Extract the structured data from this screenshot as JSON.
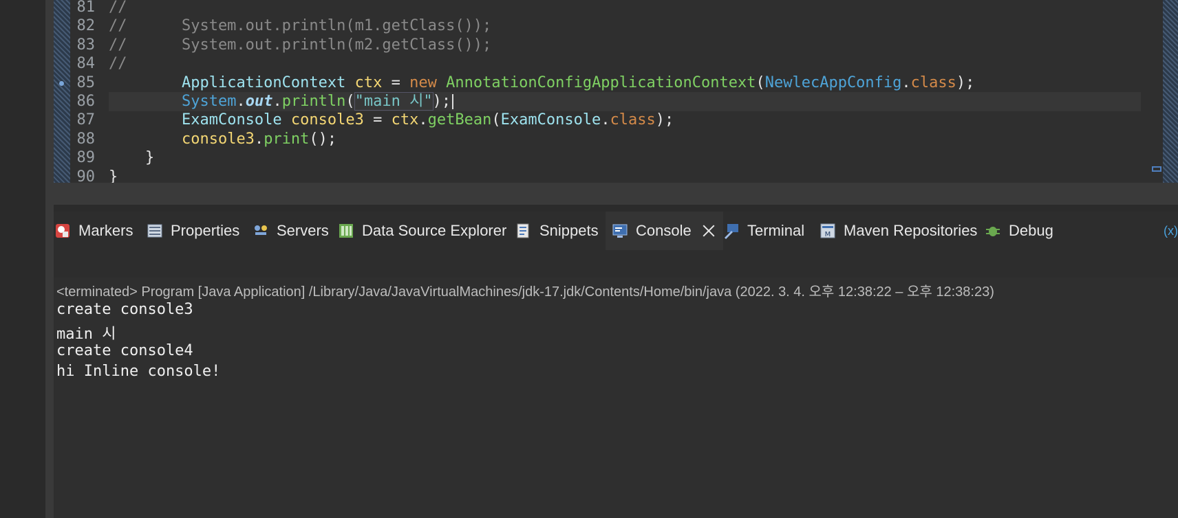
{
  "editor": {
    "lines": [
      {
        "no": "81",
        "segments": [
          {
            "t": "//",
            "c": "cm"
          }
        ]
      },
      {
        "no": "82",
        "segments": [
          {
            "t": "//      System.out.println(m1.getClass());",
            "c": "cm"
          }
        ]
      },
      {
        "no": "83",
        "segments": [
          {
            "t": "//      System.out.println(m2.getClass());",
            "c": "cm"
          }
        ]
      },
      {
        "no": "84",
        "segments": [
          {
            "t": "//",
            "c": "cm"
          }
        ]
      },
      {
        "no": "85",
        "bp": true,
        "segments": [
          {
            "t": "        ",
            "c": "pl"
          },
          {
            "t": "ApplicationContext",
            "c": "ty"
          },
          {
            "t": " ",
            "c": "pl"
          },
          {
            "t": "ctx",
            "c": "vr"
          },
          {
            "t": " = ",
            "c": "pl"
          },
          {
            "t": "new",
            "c": "kw"
          },
          {
            "t": " ",
            "c": "pl"
          },
          {
            "t": "AnnotationConfigApplicationContext",
            "c": "cl"
          },
          {
            "t": "(",
            "c": "pl"
          },
          {
            "t": "NewlecAppConfig",
            "c": "cl2"
          },
          {
            "t": ".",
            "c": "pl"
          },
          {
            "t": "class",
            "c": "kw"
          },
          {
            "t": ");",
            "c": "pl"
          }
        ]
      },
      {
        "no": "86",
        "current": true,
        "segments": [
          {
            "t": "        ",
            "c": "pl"
          },
          {
            "t": "System",
            "c": "cl2"
          },
          {
            "t": ".",
            "c": "pl"
          },
          {
            "t": "out",
            "c": "fld"
          },
          {
            "t": ".",
            "c": "pl"
          },
          {
            "t": "println",
            "c": "cl"
          },
          {
            "t": "(",
            "c": "pl"
          },
          {
            "t": "\"main 시\"",
            "c": "str"
          },
          {
            "t": ");",
            "c": "pl"
          }
        ]
      },
      {
        "no": "87",
        "segments": [
          {
            "t": "        ",
            "c": "pl"
          },
          {
            "t": "ExamConsole",
            "c": "ty"
          },
          {
            "t": " ",
            "c": "pl"
          },
          {
            "t": "console3",
            "c": "vr"
          },
          {
            "t": " = ",
            "c": "pl"
          },
          {
            "t": "ctx",
            "c": "vr"
          },
          {
            "t": ".",
            "c": "pl"
          },
          {
            "t": "getBean",
            "c": "cl"
          },
          {
            "t": "(",
            "c": "pl"
          },
          {
            "t": "ExamConsole",
            "c": "ty"
          },
          {
            "t": ".",
            "c": "pl"
          },
          {
            "t": "class",
            "c": "kw"
          },
          {
            "t": ");",
            "c": "pl"
          }
        ]
      },
      {
        "no": "88",
        "segments": [
          {
            "t": "        ",
            "c": "pl"
          },
          {
            "t": "console3",
            "c": "vr"
          },
          {
            "t": ".",
            "c": "pl"
          },
          {
            "t": "print",
            "c": "cl"
          },
          {
            "t": "();",
            "c": "pl"
          }
        ]
      },
      {
        "no": "89",
        "segments": [
          {
            "t": "    }",
            "c": "pl"
          }
        ]
      },
      {
        "no": "90",
        "segments": [
          {
            "t": "}",
            "c": "pl"
          }
        ]
      }
    ]
  },
  "tabs": [
    {
      "label": "Markers",
      "icon": "markers-icon"
    },
    {
      "label": "Properties",
      "icon": "properties-icon"
    },
    {
      "label": "Servers",
      "icon": "servers-icon"
    },
    {
      "label": "Data Source Explorer",
      "icon": "data-source-icon"
    },
    {
      "label": "Snippets",
      "icon": "snippets-icon"
    },
    {
      "label": "Console",
      "icon": "console-icon",
      "active": true
    },
    {
      "label": "Terminal",
      "icon": "terminal-icon"
    },
    {
      "label": "Maven Repositories",
      "icon": "maven-icon"
    },
    {
      "label": "Debug",
      "icon": "debug-icon"
    }
  ],
  "tab_overflow": "(x)",
  "console": {
    "header": "<terminated> Program [Java Application] /Library/Java/JavaVirtualMachines/jdk-17.jdk/Contents/Home/bin/java  (2022. 3. 4. 오후 12:38:22 – 오후 12:38:23)",
    "output": [
      "create console3",
      "main 시",
      "create console4",
      "hi Inline console!"
    ]
  }
}
